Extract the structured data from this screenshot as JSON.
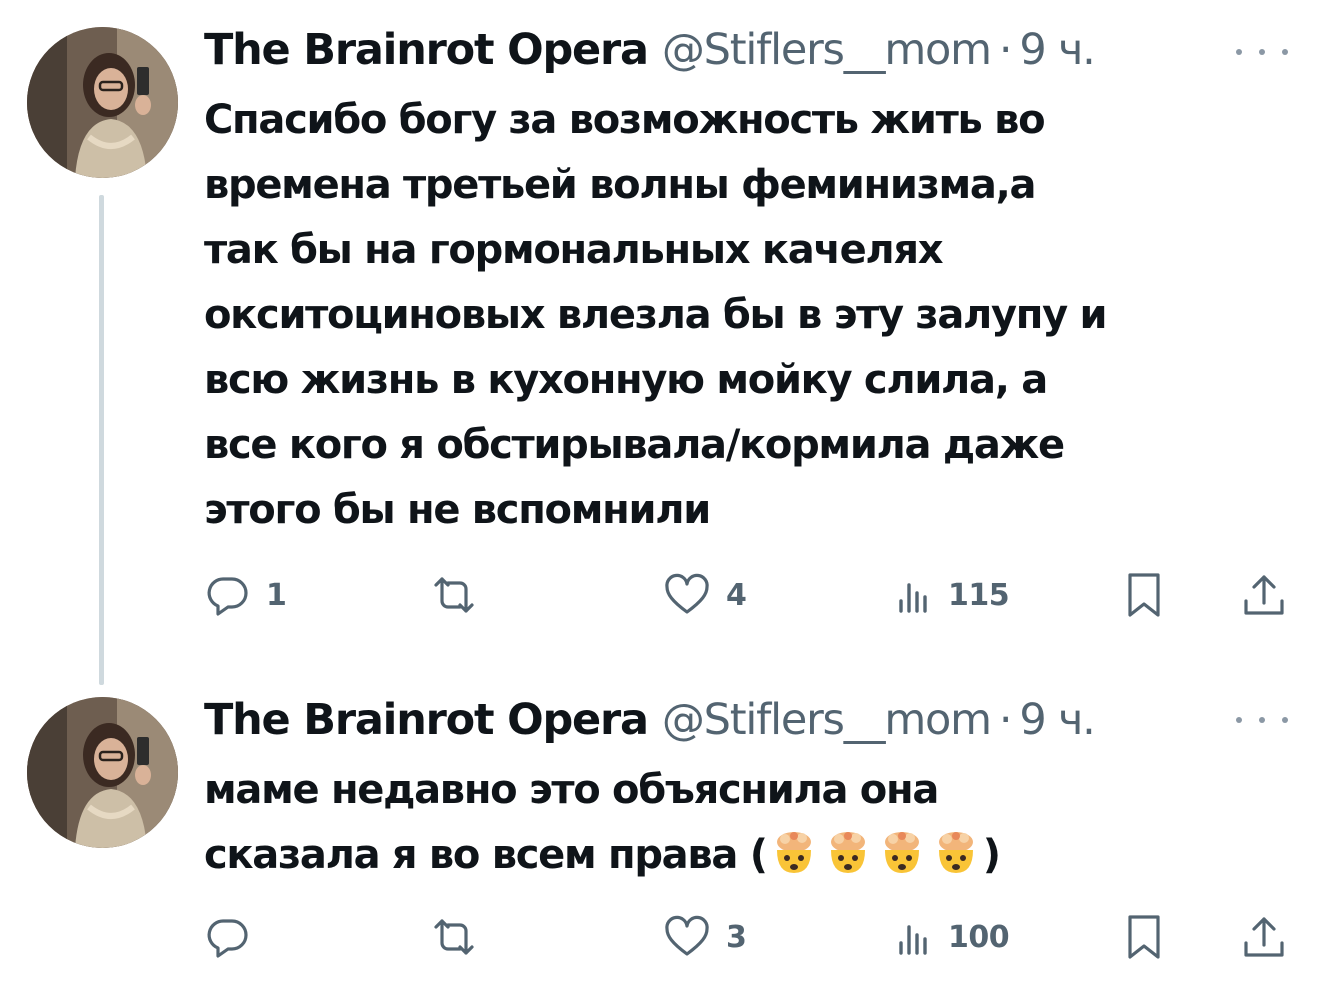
{
  "tweets": [
    {
      "display_name": "The Brainrot Opera",
      "handle": "@Stiflers__mom",
      "separator": "·",
      "time": "9 ч.",
      "text_lines": [
        "Спасибо богу за возможность жить во",
        "времена третьей волны феминизма,а",
        "так бы на гормональных качелях",
        "окситоциновых влезла бы в эту залупу и",
        "всю жизнь в кухонную мойку слила, а",
        "все кого я обстирывала/кормила даже",
        "этого бы не вспомнили"
      ],
      "replies": "1",
      "reposts": "",
      "likes": "4",
      "views": "115"
    },
    {
      "display_name": "The Brainrot Opera",
      "handle": "@Stiflers__mom",
      "separator": "·",
      "time": "9 ч.",
      "text_line_1": "маме недавно это объяснила она",
      "text_line_2_start": "сказала я во всем права (",
      "text_line_2_end": ")",
      "emoji_name": "exploding-head-emoji",
      "replies": "",
      "reposts": "",
      "likes": "3",
      "views": "100"
    }
  ],
  "icons": {
    "more": "more-horizontal-icon",
    "reply": "reply-icon",
    "repost": "repost-icon",
    "like": "heart-icon",
    "views": "views-chart-icon",
    "bookmark": "bookmark-icon",
    "share": "share-icon"
  },
  "colors": {
    "text_primary": "#0f1419",
    "text_secondary": "#536471",
    "thread_line": "#cfd9de",
    "emoji_face": "#f9c437"
  }
}
